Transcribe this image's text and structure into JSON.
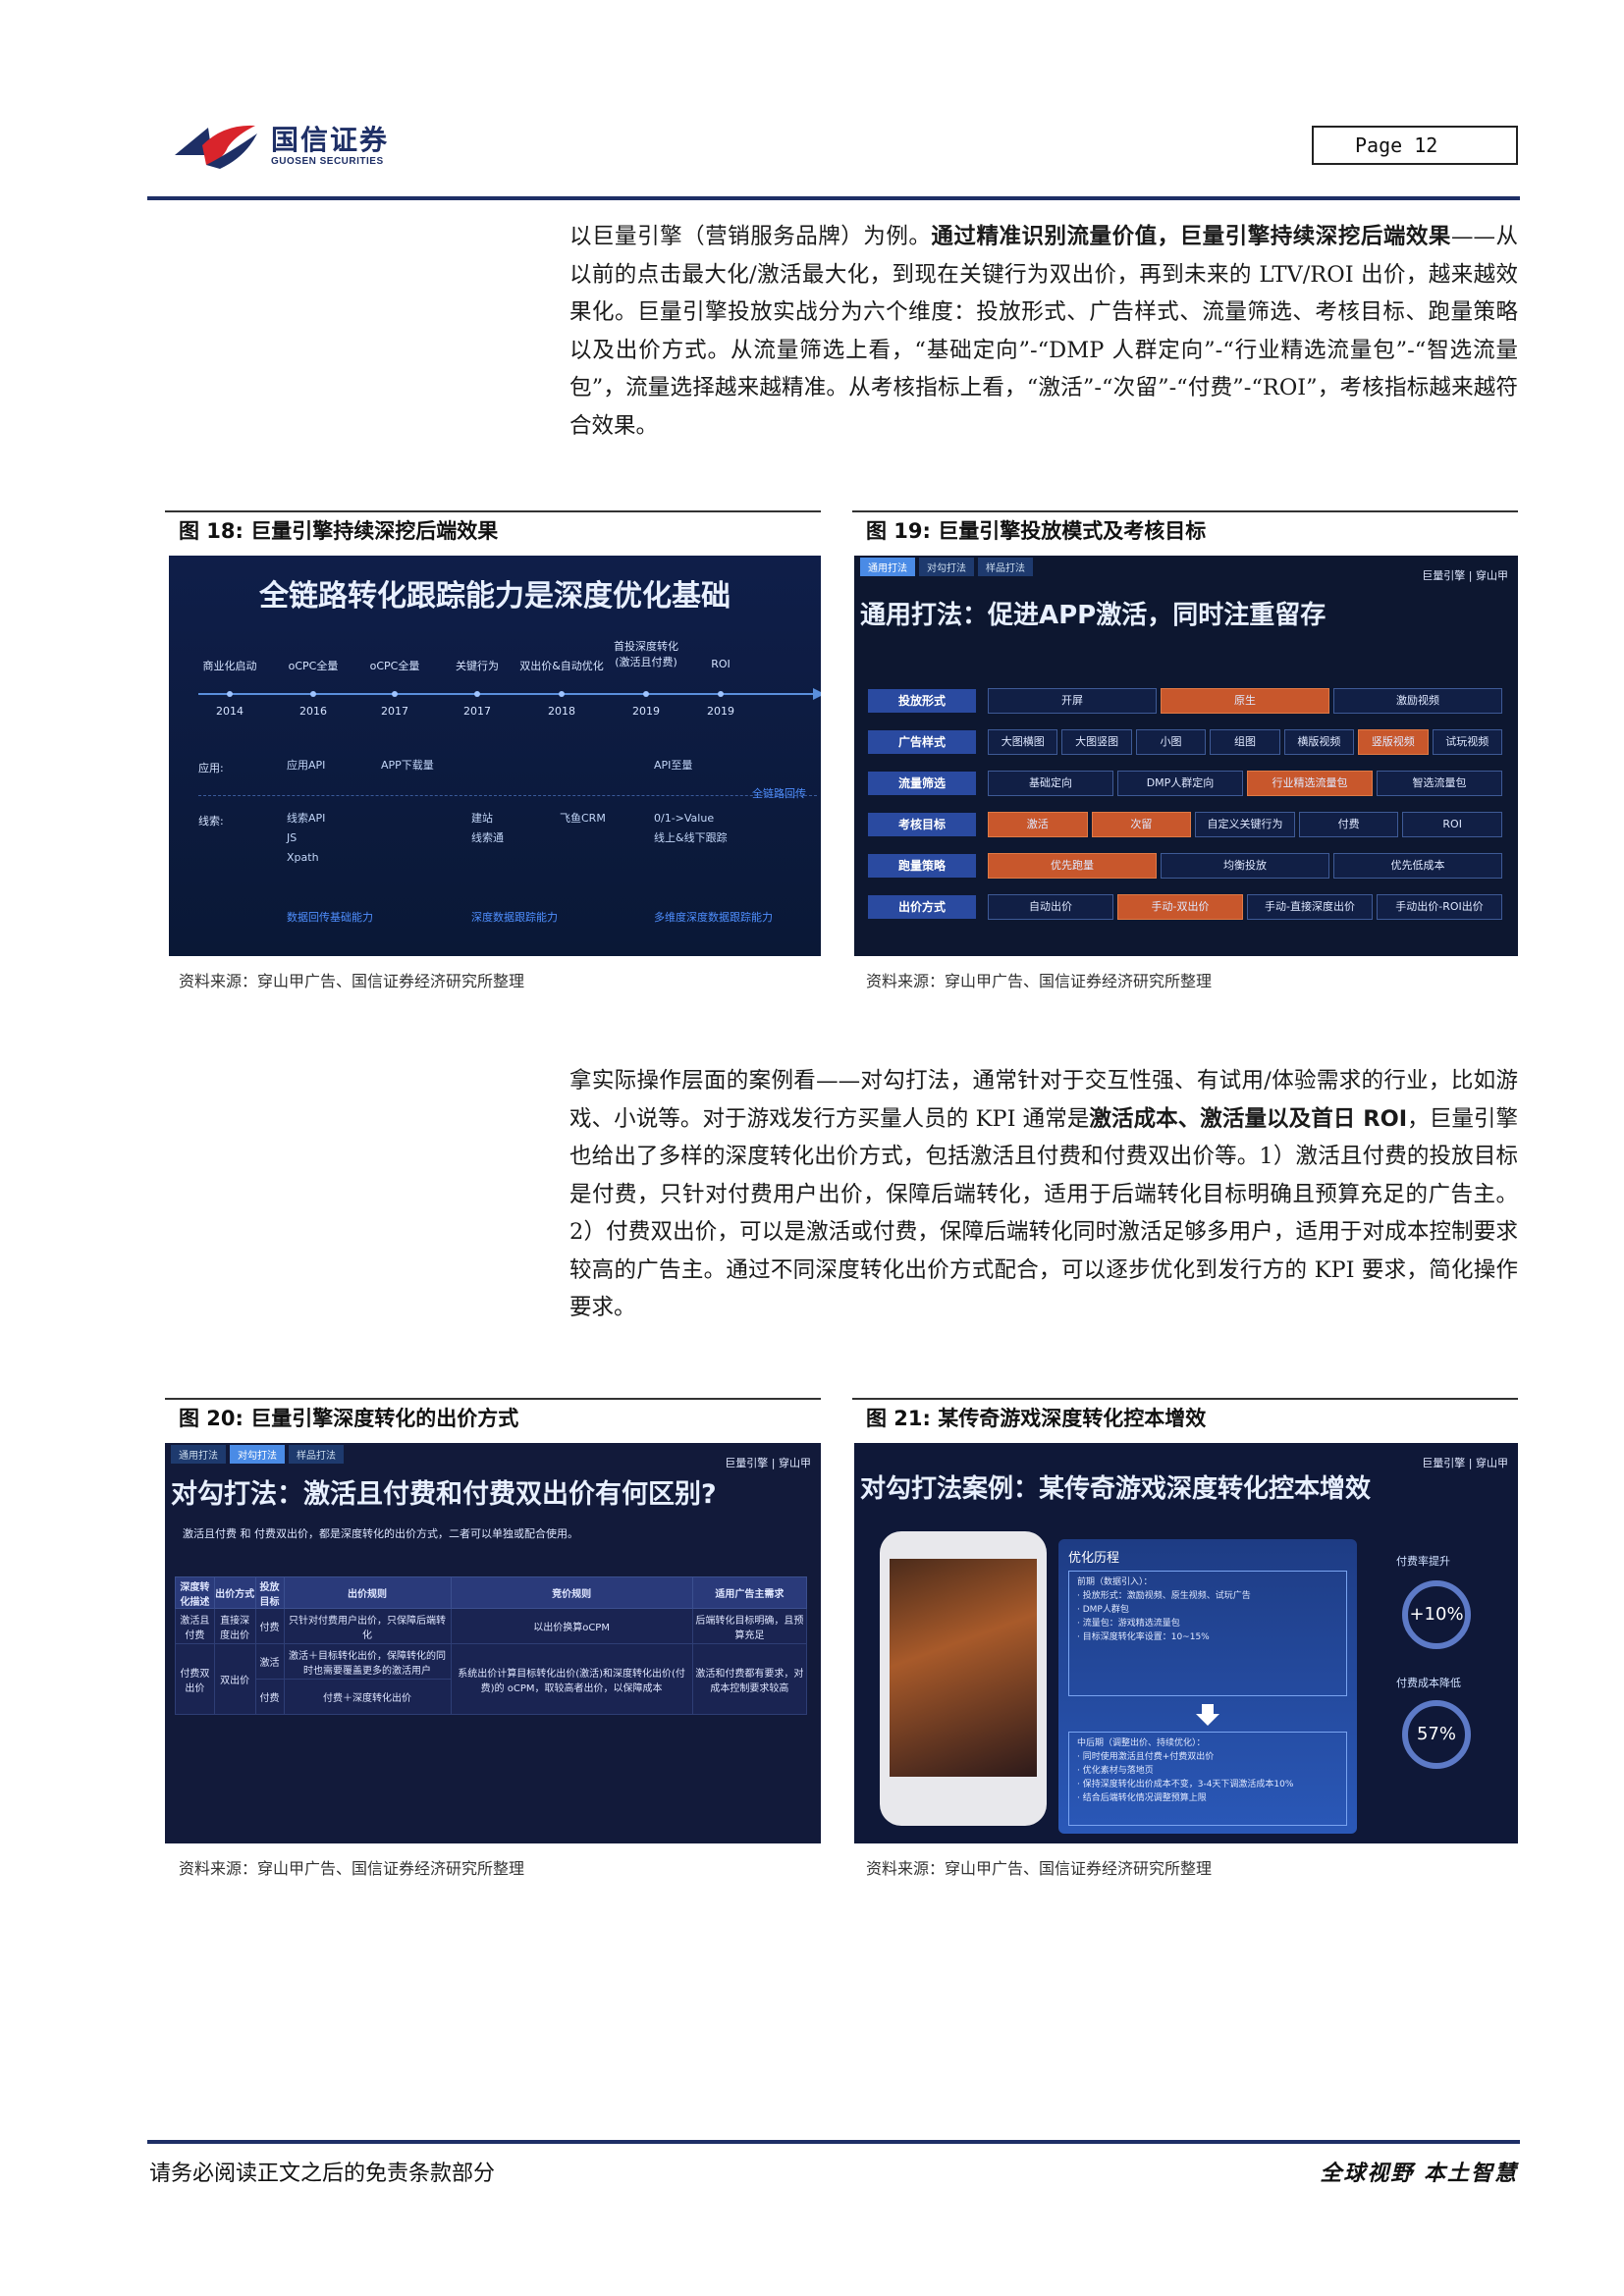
{
  "header": {
    "logo_cn": "国信证券",
    "logo_en": "GUOSEN SECURITIES",
    "page_label": "Page  12"
  },
  "para1": {
    "p1": "以巨量引擎（营销服务品牌）为例。",
    "b1": "通过精准识别流量价值，巨量引擎持续深挖后端效果",
    "p2": "——从以前的点击最大化/激活最大化，到现在关键行为双出价，再到未来的 LTV/ROI 出价，越来越效果化。巨量引擎投放实战分为六个维度：投放形式、广告样式、流量筛选、考核目标、跑量策略以及出价方式。从流量筛选上看，“基础定向”-“DMP 人群定向”-“行业精选流量包”-“智选流量包”，流量选择越来越精准。从考核指标上看，“激活”-“次留”-“付费”-“ROI”，考核指标越来越符合效果。"
  },
  "para2": {
    "p1": "拿实际操作层面的案例看——对勾打法，通常针对于交互性强、有试用/体验需求的行业，比如游戏、小说等。对于游戏发行方买量人员的 KPI 通常是",
    "b1": "激活成本、激活量以及首日 ROI",
    "p2": "，巨量引擎也给出了多样的深度转化出价方式，包括激活且付费和付费双出价等。1）激活且付费的投放目标是付费，只针对付费用户出价，保障后端转化，适用于后端转化目标明确且预算充足的广告主。2）付费双出价，可以是激活或付费，保障后端转化同时激活足够多用户，适用于对成本控制要求较高的广告主。通过不同深度转化出价方式配合，可以逐步优化到发行方的 KPI 要求，简化操作要求。"
  },
  "figures": {
    "fig18": {
      "title": "图 18:  巨量引擎持续深挖后端效果",
      "source": "资料来源：穿山甲广告、国信证券经济研究所整理",
      "slide_title": "全链路转化跟踪能力是深度优化基础",
      "nodes": [
        {
          "label": "商业化启动",
          "year": "2014"
        },
        {
          "label": "oCPC全量",
          "year": "2016"
        },
        {
          "label": "oCPC全量",
          "year": "2017"
        },
        {
          "label": "关键行为",
          "year": "2017"
        },
        {
          "label": "双出价&自动优化",
          "year": "2018"
        },
        {
          "label": "首投深度转化\n(激活且付费)",
          "year": "2019"
        },
        {
          "label": "ROI",
          "year": "2019"
        }
      ],
      "row1_label": "应用:",
      "row1_cells": [
        "应用API",
        "APP下载量",
        "API至量"
      ],
      "row2_label": "线索:",
      "row2_cells": [
        "线索API\nJS\nXpath",
        "建站\n线索通",
        "飞鱼CRM",
        "0/1->Value\n线上&线下跟踪"
      ],
      "highlights": [
        "数据回传基础能力",
        "深度数据跟踪能力",
        "多维度深度数据跟踪能力",
        "全链路回传"
      ]
    },
    "fig19": {
      "title": "图 19:  巨量引擎投放模式及考核目标",
      "source": "资料来源：穿山甲广告、国信证券经济研究所整理",
      "tabs": [
        "通用打法",
        "对勾打法",
        "样品打法"
      ],
      "brand": "巨量引擎 | 穿山甲",
      "slide_title": "通用打法：促进APP激活，同时注重留存",
      "rows": [
        {
          "label": "投放形式",
          "cells": [
            {
              "t": "开屏",
              "on": false
            },
            {
              "t": "原生",
              "on": true
            },
            {
              "t": "激励视频",
              "on": false
            }
          ]
        },
        {
          "label": "广告样式",
          "cells": [
            {
              "t": "大图横图",
              "on": false
            },
            {
              "t": "大图竖图",
              "on": false
            },
            {
              "t": "小图",
              "on": false
            },
            {
              "t": "组图",
              "on": false
            },
            {
              "t": "横版视频",
              "on": false
            },
            {
              "t": "竖版视频",
              "on": true
            },
            {
              "t": "试玩视频",
              "on": false
            }
          ]
        },
        {
          "label": "流量筛选",
          "cells": [
            {
              "t": "基础定向",
              "on": false
            },
            {
              "t": "DMP人群定向",
              "on": false
            },
            {
              "t": "行业精选流量包",
              "on": true
            },
            {
              "t": "智选流量包",
              "on": false
            }
          ]
        },
        {
          "label": "考核目标",
          "cells": [
            {
              "t": "激活",
              "on": true
            },
            {
              "t": "次留",
              "on": true
            },
            {
              "t": "自定义关键行为",
              "on": false
            },
            {
              "t": "付费",
              "on": false
            },
            {
              "t": "ROI",
              "on": false
            }
          ]
        },
        {
          "label": "跑量策略",
          "cells": [
            {
              "t": "优先跑量",
              "on": true
            },
            {
              "t": "均衡投放",
              "on": false
            },
            {
              "t": "优先低成本",
              "on": false
            }
          ]
        },
        {
          "label": "出价方式",
          "cells": [
            {
              "t": "自动出价",
              "on": false
            },
            {
              "t": "手动-双出价",
              "on": true
            },
            {
              "t": "手动-直接深度出价",
              "on": false
            },
            {
              "t": "手动出价-ROI出价",
              "on": false
            }
          ]
        }
      ]
    },
    "fig20": {
      "title": "图 20:  巨量引擎深度转化的出价方式",
      "source": "资料来源：穿山甲广告、国信证券经济研究所整理",
      "tabs": [
        "通用打法",
        "对勾打法",
        "样品打法"
      ],
      "brand": "巨量引擎 | 穿山甲",
      "slide_title": "对勾打法：激活且付费和付费双出价有何区别?",
      "subtitle": "激活且付费 和 付费双出价，都是深度转化的出价方式，二者可以单独或配合使用。",
      "headers": [
        "深度转化描述",
        "出价方式",
        "投放目标",
        "出价规则",
        "竞价规则",
        "适用广告主需求"
      ],
      "rows": [
        [
          "激活且付费",
          "直接深度出价",
          "付费",
          "只针对付费用户出价，只保障后端转化",
          "以出价换算oCPM",
          "后端转化目标明确，且预算充足"
        ],
        [
          "付费双出价",
          "双出价",
          "激活",
          "激活＋目标转化出价，保障转化的同时也需要覆盖更多的激活用户",
          "系统出价计算目标转化出价(激活)和深度转化出价(付费)的 oCPM，取较高者出价，以保障成本",
          "激活和付费都有要求，对成本控制要求较高"
        ],
        [
          "",
          "",
          "付费",
          "付费＋深度转化出价",
          "",
          ""
        ]
      ]
    },
    "fig21": {
      "title": "图 21:  某传奇游戏深度转化控本增效",
      "source": "资料来源：穿山甲广告、国信证券经济研究所整理",
      "brand": "巨量引擎 | 穿山甲",
      "slide_title": "对勾打法案例：某传奇游戏深度转化控本增效",
      "panel_title": "优化历程",
      "box1": "前期（数据引入）：\n· 投放形式：激励视频、原生视频、试玩广告\n· DMP人群包\n· 流量包：游戏精选流量包\n· 目标深度转化率设置：10~15%",
      "box2": "中后期（调整出价、持续优化）：\n· 同时使用激活且付费+付费双出价\n· 优化素材与落地页\n· 保持深度转化出价成本不变，3-4天下调激活成本10%\n· 结合后端转化情况调整预算上限",
      "metric1_label": "付费率提升",
      "metric1_value": "+10%",
      "metric2_label": "付费成本降低",
      "metric2_value": "57%"
    }
  },
  "footer": {
    "left": "请务必阅读正文之后的免责条款部分",
    "right": "全球视野   本土智慧"
  },
  "colors": {
    "brand_navy": "#1e2f66",
    "brand_red": "#d9242b",
    "slide_bg": "#0c1a3a",
    "highlight_orange": "#c8572c"
  }
}
